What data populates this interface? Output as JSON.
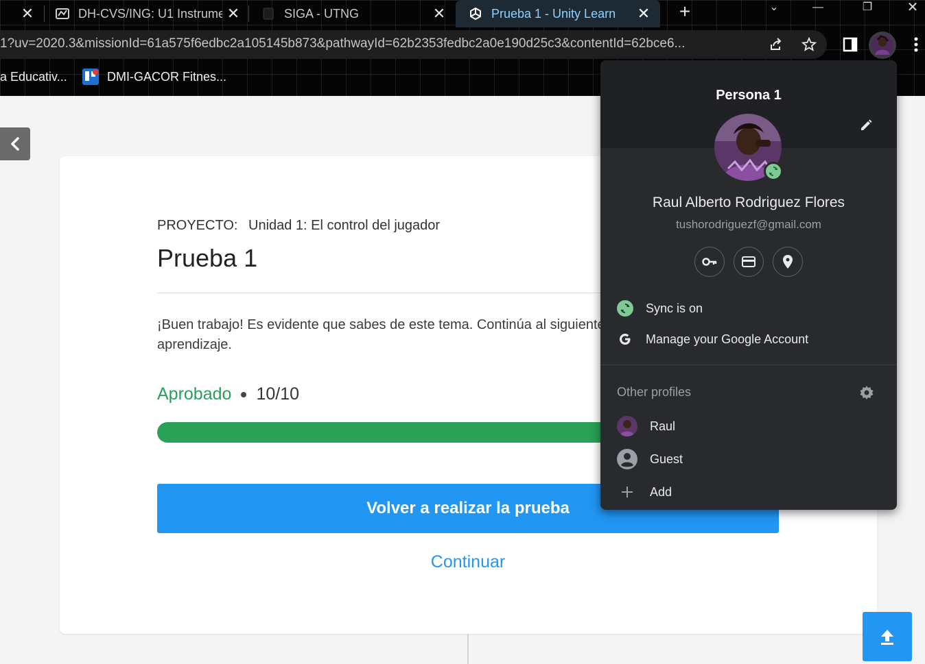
{
  "browser": {
    "tabs": [
      {
        "title": "",
        "favicon": "close-icon"
      },
      {
        "title": "DH-CVS/ING: U1 Instrume",
        "favicon": "moodle-icon"
      },
      {
        "title": "SIGA - UTNG",
        "favicon": "page-icon"
      },
      {
        "title": "Prueba 1 - Unity Learn",
        "favicon": "unity-icon",
        "active": true
      }
    ],
    "url": "1?uv=2020.3&missionId=61a575f6edbc2a105145b873&pathwayId=62b2353fedbc2a0e190d25c3&contentId=62bce6...",
    "bookmarks": [
      {
        "label": "a Educativ..."
      },
      {
        "label": "DMI-GACOR Fitnes..."
      }
    ]
  },
  "page": {
    "kicker_label": "PROYECTO:",
    "kicker_value": "Unidad 1: El control del jugador",
    "title": "Prueba 1",
    "message": "¡Buen trabajo! Es evidente que sabes de este tema. Continúa al siguiente paso de tu camino de aprendizaje.",
    "status": "Aprobado",
    "score": "10/10",
    "progress_fraction": 1.0,
    "retry_label": "Volver a realizar la prueba",
    "continue_label": "Continuar"
  },
  "profile_popup": {
    "header": "Persona 1",
    "name": "Raul Alberto Rodriguez Flores",
    "email": "tushorodriguezf@gmail.com",
    "sync_label": "Sync is on",
    "manage_label": "Manage your Google Account",
    "other_profiles_label": "Other profiles",
    "profiles": [
      {
        "label": "Raul"
      },
      {
        "label": "Guest"
      },
      {
        "label": "Add"
      }
    ]
  },
  "colors": {
    "accent": "#2196f3",
    "success": "#27a05a",
    "popup_bg": "#292a2d"
  }
}
